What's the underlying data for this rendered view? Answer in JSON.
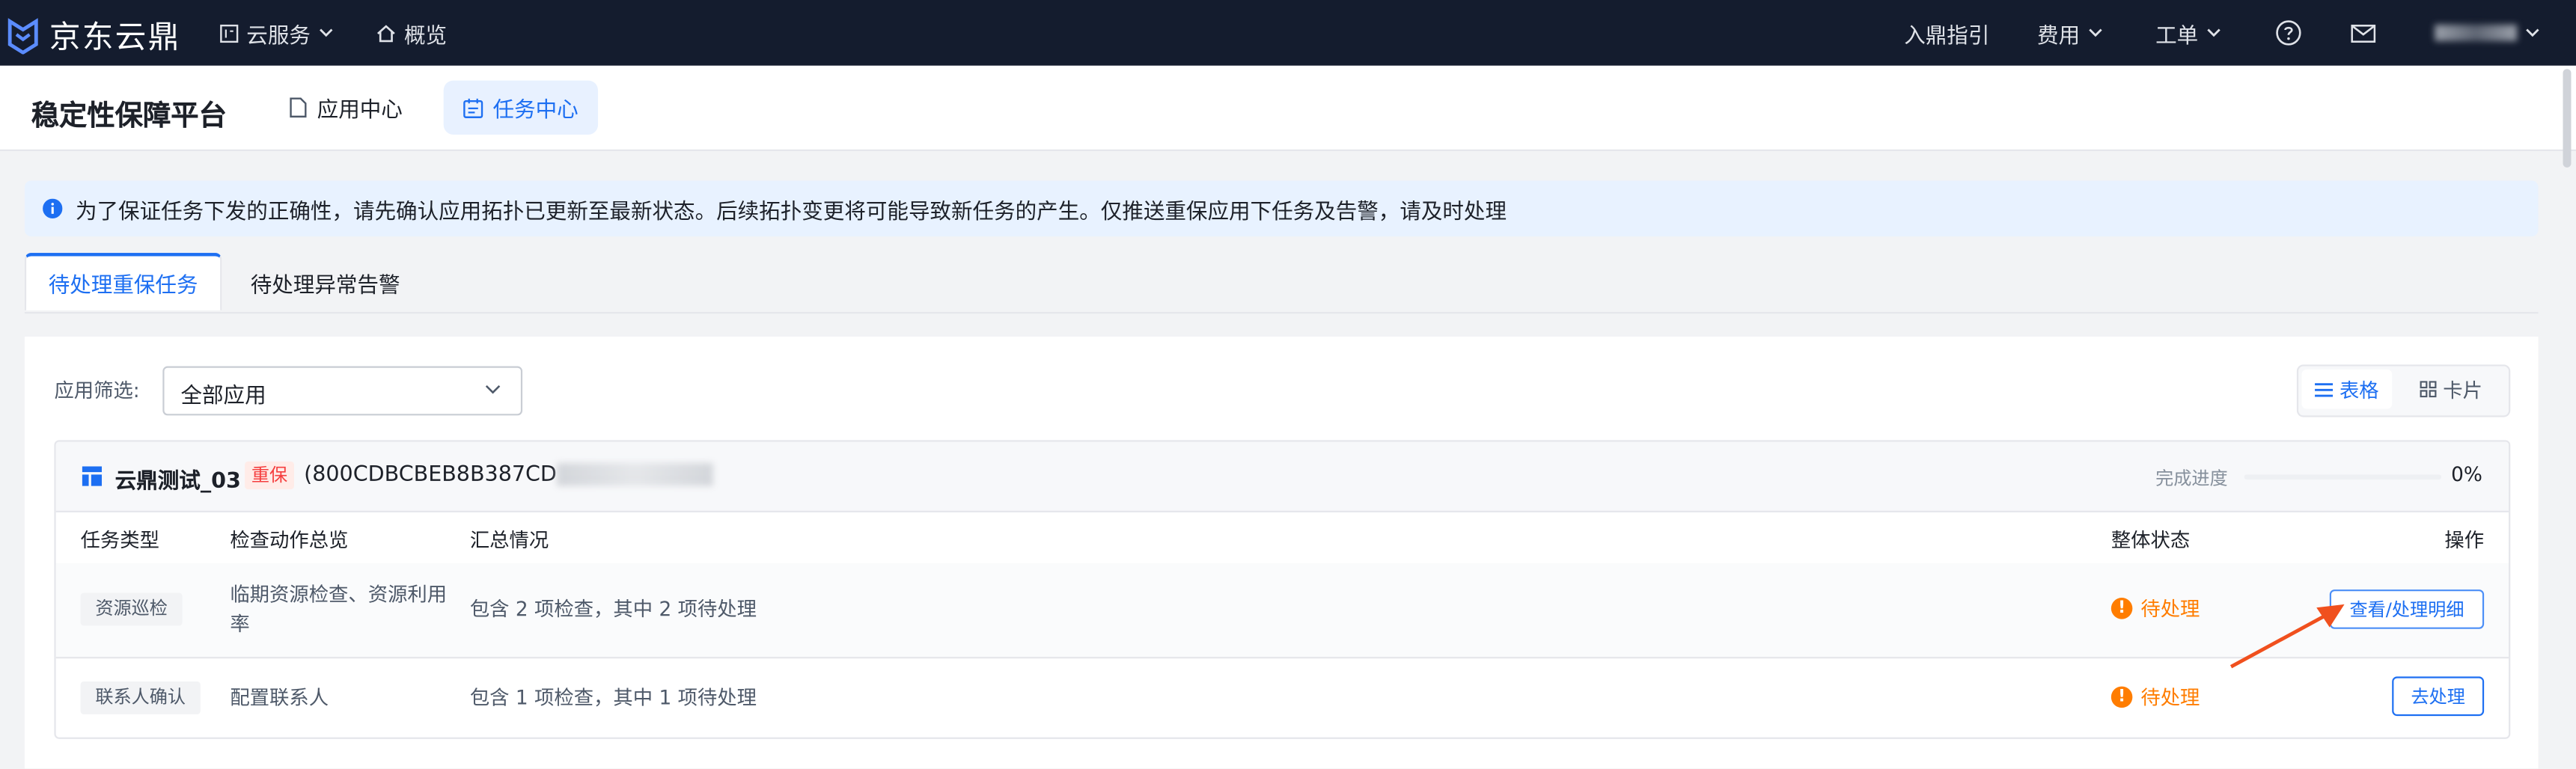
{
  "topnav": {
    "brand": "京东云鼎",
    "cloud_services": "云服务",
    "overview": "概览",
    "guide": "入鼎指引",
    "billing": "费用",
    "ticket": "工单",
    "help_icon": "question-circle-icon",
    "mail_icon": "mail-icon"
  },
  "subhead": {
    "title": "稳定性保障平台",
    "tabs": [
      {
        "label": "应用中心",
        "icon": "document-icon"
      },
      {
        "label": "任务中心",
        "icon": "calendar-icon",
        "active": true
      }
    ]
  },
  "notice": {
    "text": "为了保证任务下发的正确性，请先确认应用拓扑已更新至最新状态。后续拓扑变更将可能导致新任务的产生。仅推送重保应用下任务及告警，请及时处理"
  },
  "tabs": [
    {
      "label": "待处理重保任务",
      "active": true
    },
    {
      "label": "待处理异常告警"
    }
  ],
  "filter": {
    "label": "应用筛选:",
    "value": "全部应用"
  },
  "view_toggle": {
    "table": "表格",
    "card": "卡片",
    "active": "table"
  },
  "app": {
    "name": "云鼎测试_03",
    "badge": "重保",
    "id_prefix": "(800CDBCBEB8B387CD",
    "progress_label": "完成进度",
    "progress_value": "0%",
    "progress_fraction": 0,
    "columns": {
      "type": "任务类型",
      "actions_overview": "检查动作总览",
      "summary": "汇总情况",
      "status": "整体状态",
      "operation": "操作"
    },
    "rows": [
      {
        "type": "资源巡检",
        "actions": "临期资源检查、资源利用率",
        "summary": "包含 2 项检查，其中 2 项待处理",
        "status": "待处理",
        "button": "查看/处理明细"
      },
      {
        "type": "联系人确认",
        "actions": "配置联系人",
        "summary": "包含 1 项检查，其中 1 项待处理",
        "status": "待处理",
        "button": "去处理"
      }
    ]
  },
  "colors": {
    "nav_bg": "#141c2e",
    "accent": "#1d6ff2",
    "warning": "#ff7d00",
    "annotation_arrow": "#f0501e"
  }
}
